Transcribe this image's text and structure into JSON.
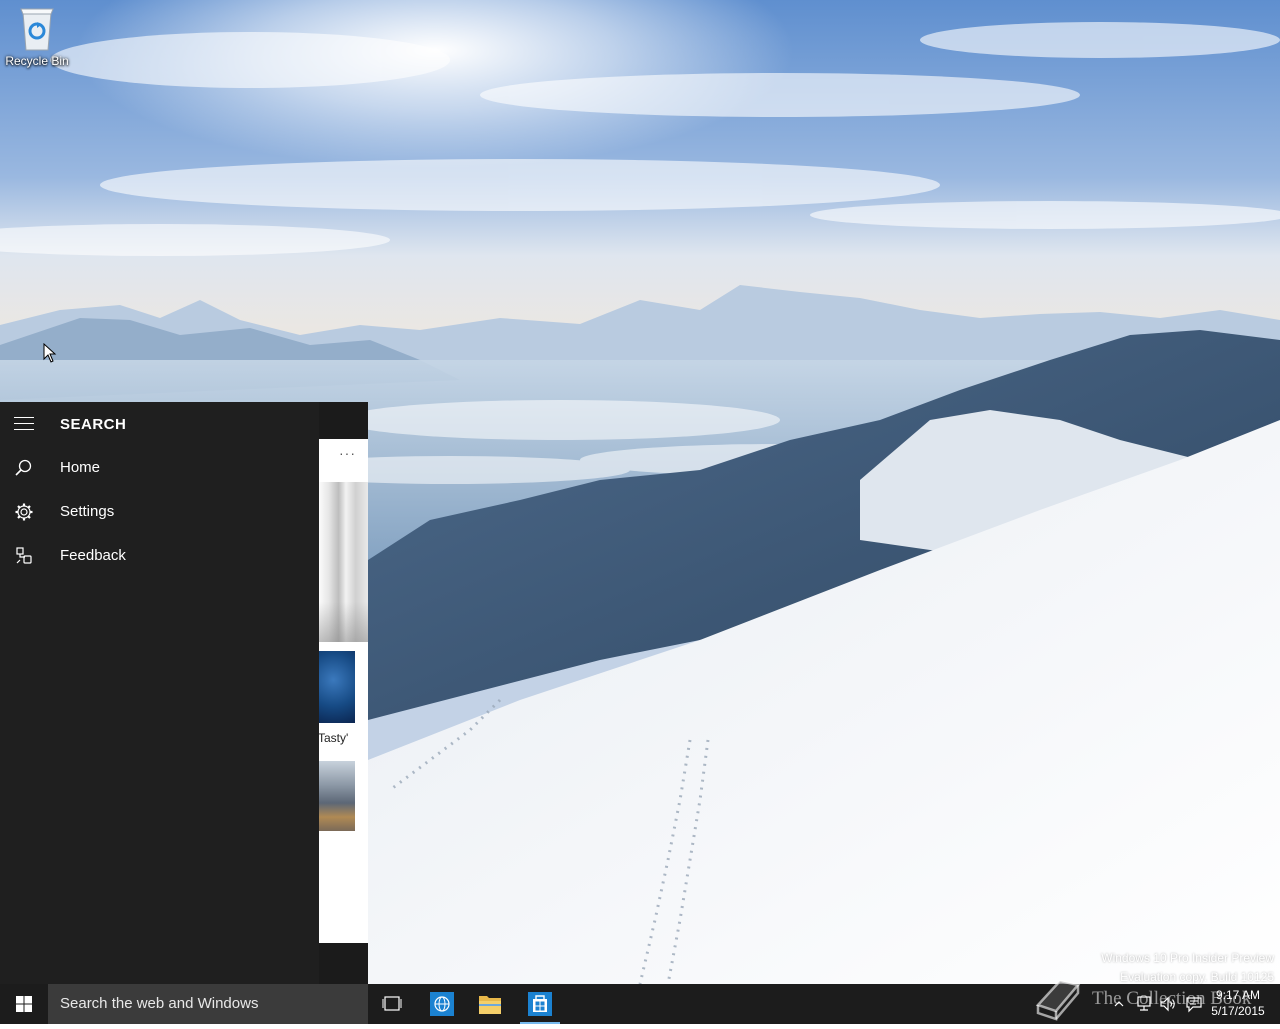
{
  "desktop": {
    "recycle_bin_label": "Recycle Bin"
  },
  "search_panel": {
    "title": "SEARCH",
    "menu": [
      {
        "label": "Home",
        "icon": "search-icon"
      },
      {
        "label": "Settings",
        "icon": "gear-icon"
      },
      {
        "label": "Feedback",
        "icon": "feedback-icon"
      }
    ],
    "content": {
      "more_label": "···",
      "snippet_text": "Tasty'"
    }
  },
  "taskbar": {
    "search_placeholder": "Search the web and Windows",
    "pinned": [
      {
        "name": "Task View",
        "icon": "task-view-icon"
      },
      {
        "name": "Internet Explorer",
        "icon": "globe-icon"
      },
      {
        "name": "File Explorer",
        "icon": "folder-icon"
      },
      {
        "name": "Store",
        "icon": "store-icon"
      }
    ],
    "clock": {
      "time": "9:17 AM",
      "date": "5/17/2015"
    }
  },
  "watermark": {
    "line1": "Windows 10 Pro Insider Preview",
    "line2": "Evaluation copy. Build 10125",
    "brand": "The Collection Book"
  },
  "colors": {
    "taskbar": "#1c1c1c",
    "search_box": "#3b3b3b",
    "flyout": "#1f1f1f",
    "accent": "#76b9ed",
    "store_blue": "#1b82d1"
  }
}
